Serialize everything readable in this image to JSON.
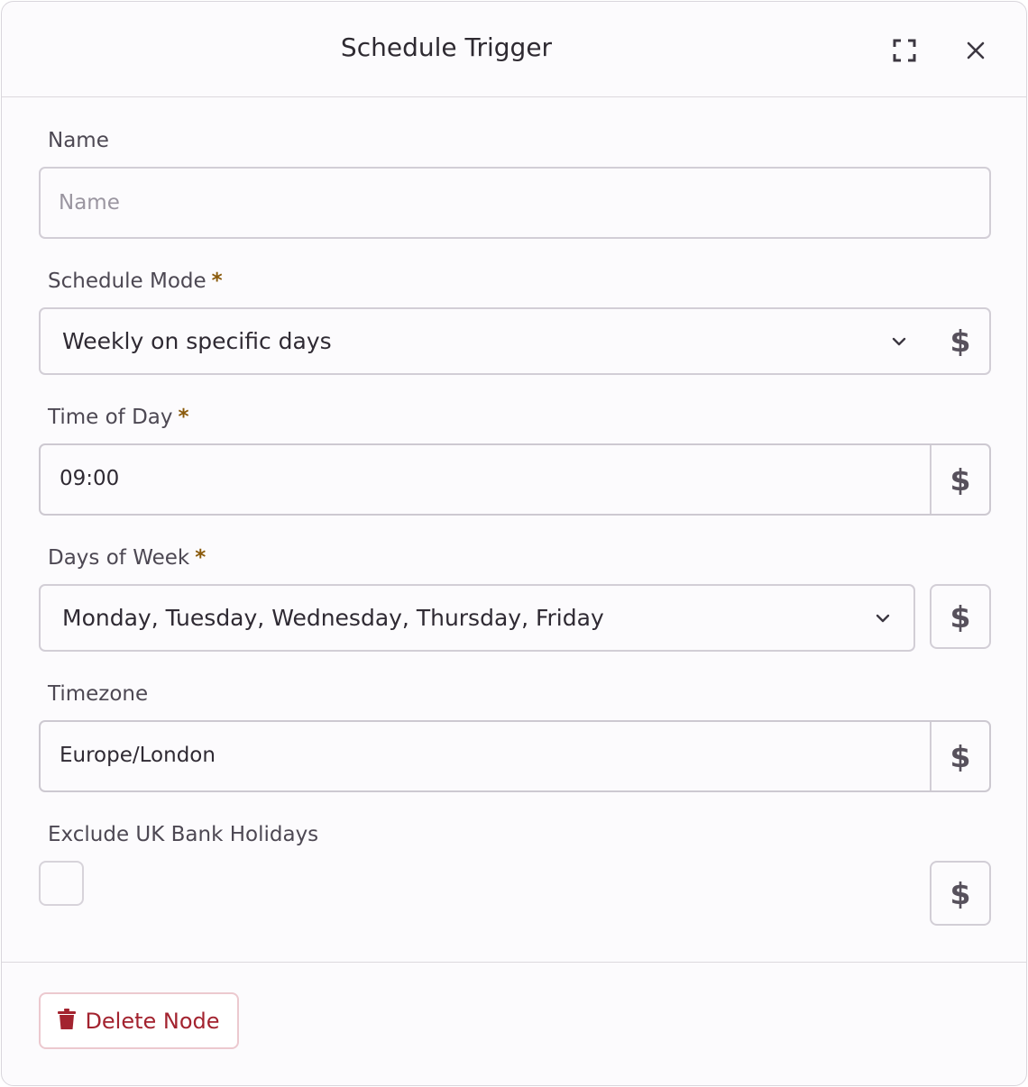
{
  "dialog": {
    "title": "Schedule Trigger",
    "expand_icon": "expand-icon",
    "close_icon": "close-icon"
  },
  "fields": {
    "name": {
      "label": "Name",
      "placeholder": "Name",
      "value": ""
    },
    "schedule_mode": {
      "label": "Schedule Mode",
      "required": "*",
      "value": "Weekly on specific days"
    },
    "time_of_day": {
      "label": "Time of Day",
      "required": "*",
      "value": "09:00"
    },
    "days_of_week": {
      "label": "Days of Week",
      "required": "*",
      "value": "Monday, Tuesday, Wednesday, Thursday, Friday"
    },
    "timezone": {
      "label": "Timezone",
      "value": "Europe/London"
    },
    "exclude_holidays": {
      "label": "Exclude UK Bank Holidays",
      "checked": false
    }
  },
  "expression_toggle": {
    "symbol": "$"
  },
  "footer": {
    "delete_label": "Delete Node",
    "delete_icon": "trash-icon"
  },
  "colors": {
    "accent_required": "#8a5a0b",
    "danger": "#a3232f"
  }
}
